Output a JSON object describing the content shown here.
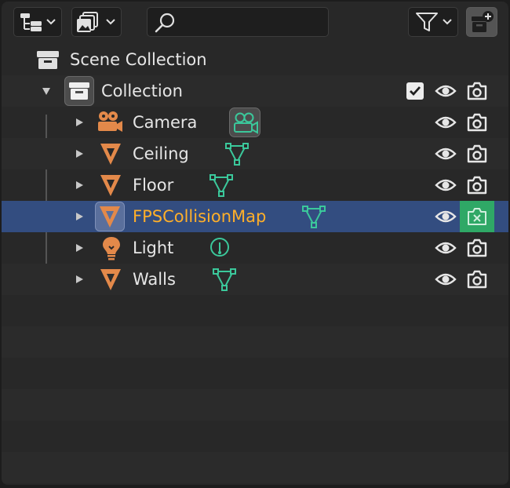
{
  "header": {
    "display_mode_icon": "outliner-tree-icon",
    "filter_icon": "funnel-icon",
    "search": {
      "value": "",
      "icon": "search-icon"
    },
    "new_collection_icon": "new-collection-icon"
  },
  "scene": {
    "label": "Scene Collection",
    "icon": "scene-collection-icon"
  },
  "collection": {
    "label": "Collection",
    "included": true
  },
  "objects": [
    {
      "label": "Camera",
      "type": "camera",
      "data_icon": "camera-data-icon"
    },
    {
      "label": "Ceiling",
      "type": "mesh",
      "data_icon": "mesh-data-icon"
    },
    {
      "label": "Floor",
      "type": "mesh",
      "data_icon": "mesh-data-icon"
    },
    {
      "label": "FPSCollisionMap",
      "type": "mesh",
      "data_icon": "mesh-data-icon",
      "selected": true,
      "render_disabled": true
    },
    {
      "label": "Light",
      "type": "light",
      "data_icon": "light-data-icon"
    },
    {
      "label": "Walls",
      "type": "mesh",
      "data_icon": "mesh-data-icon"
    }
  ],
  "colors": {
    "object_orange": "#e3894a",
    "data_green": "#3bc89b",
    "selected_row": "#334d80",
    "active_text": "#ffaf29",
    "render_disabled_bg": "#2fa866"
  }
}
